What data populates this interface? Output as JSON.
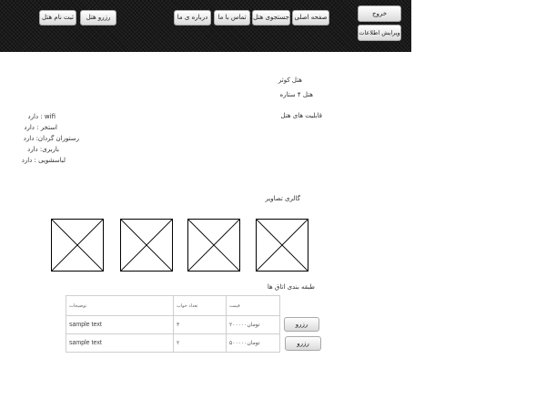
{
  "header": {
    "nav": {
      "about_label": "درباره ی ما",
      "contact_label": "تماس با ما",
      "search_label": "جستجوی هتل",
      "home_label": "صفحه اصلی"
    },
    "actions": {
      "register_label": "ثبت نام هتل",
      "reserve_label": "رزرو هتل"
    },
    "account": {
      "logout_label": "خروج",
      "edit_profile_label": "ویرایش اطلاعات"
    }
  },
  "hotel": {
    "name": "هتل کوثر",
    "stars": "هتل ۴ ستاره",
    "features_title": "قابلیت های هتل",
    "features": [
      "wifi : دارد",
      "استخر : دارد",
      "رستوران گردان: دارد",
      "باربری: دارد",
      "لباسشویی : دارد"
    ]
  },
  "gallery": {
    "title": "گالری تصاویر",
    "image_count": 4
  },
  "rooms": {
    "title": "طبقه بندی اتاق ها",
    "columns": {
      "description": "توضیحات",
      "beds": "تعداد خواب",
      "price": "قیمت"
    },
    "rows": [
      {
        "description": "sample text",
        "beds": "۳",
        "price": "تومان۲۰۰۰۰۰",
        "action": "رزرو"
      },
      {
        "description": "sample text",
        "beds": "۲",
        "price": "تومان۵۰۰۰۰۰",
        "action": "رزرو"
      }
    ]
  }
}
